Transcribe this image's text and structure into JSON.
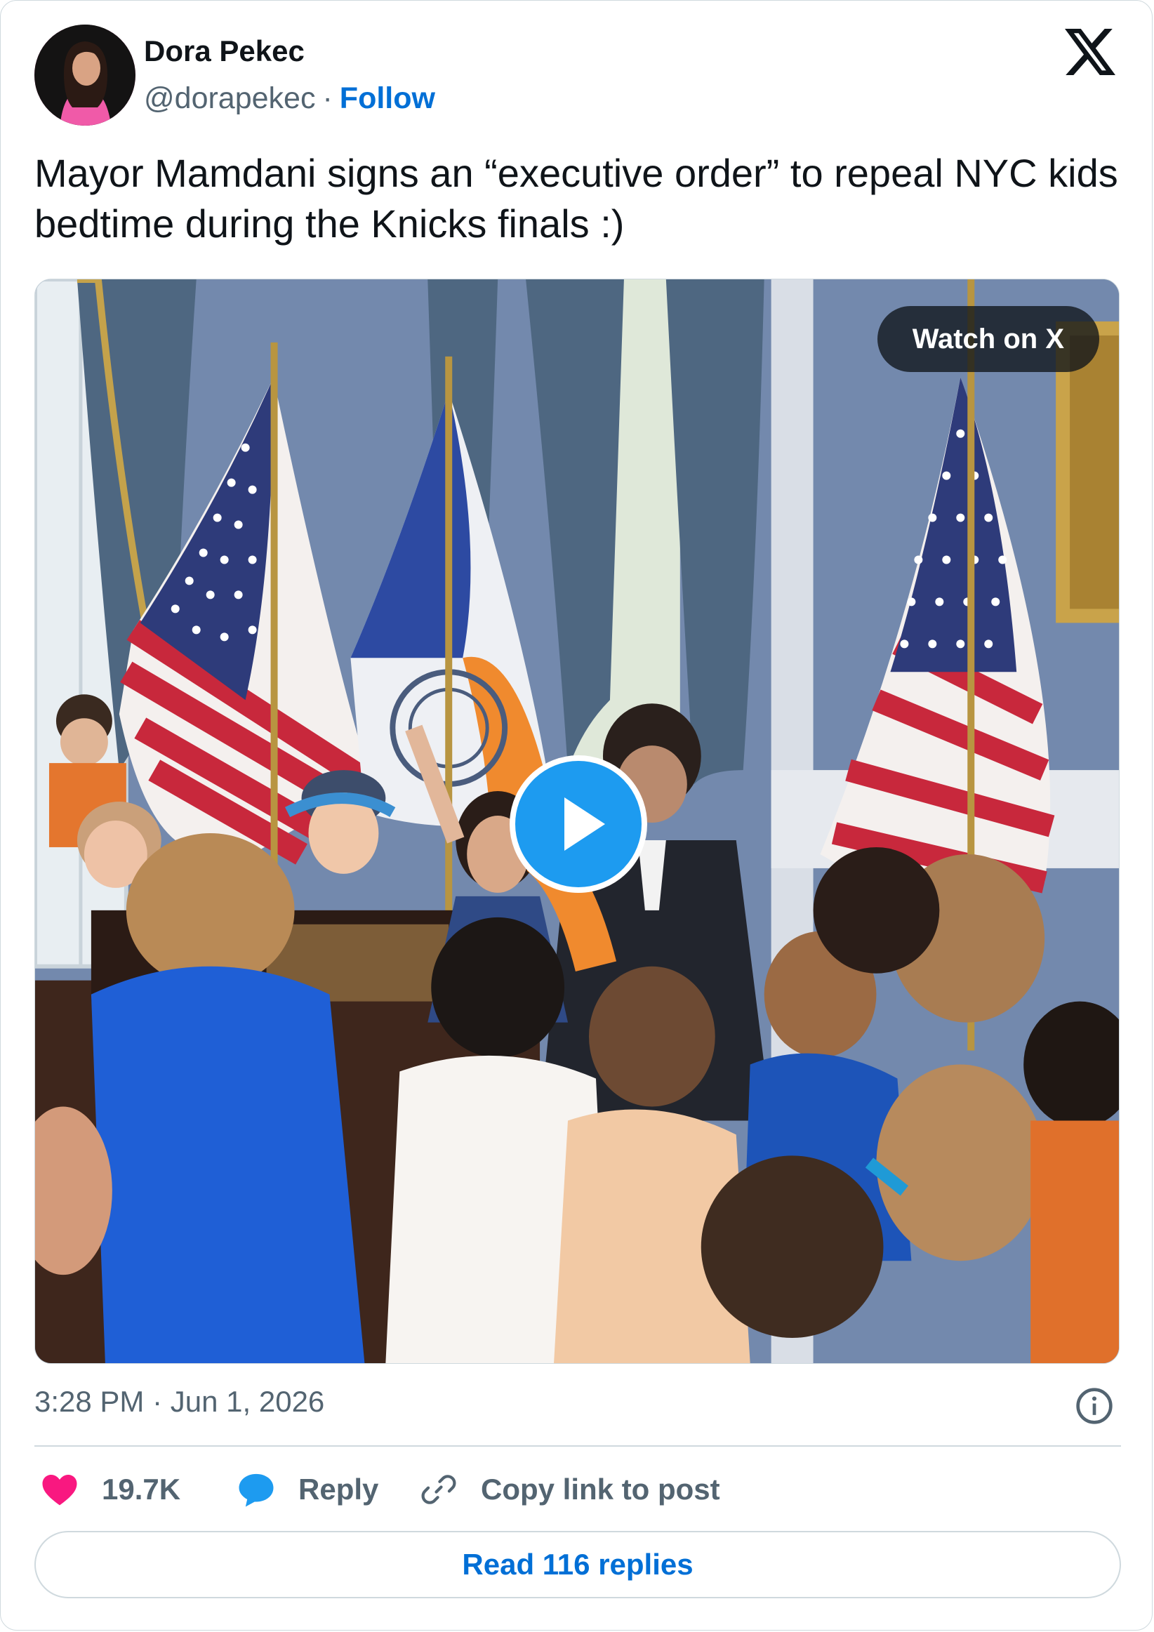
{
  "author": {
    "name": "Dora Pekec",
    "handle": "@dorapekec",
    "separator": "·",
    "follow_label": "Follow"
  },
  "brand": {
    "logo_icon": "x-logo-icon"
  },
  "tweet": {
    "text": "Mayor Mamdani signs an “executive order” to repeal NYC kids bedtime during the Knicks finals :)"
  },
  "media": {
    "watch_label": "Watch on X",
    "play_icon": "play-icon"
  },
  "meta": {
    "time": "3:28 PM",
    "separator": "·",
    "date": "Jun 1, 2026",
    "info_icon": "info-icon"
  },
  "actions": {
    "likes": "19.7K",
    "reply_label": "Reply",
    "copy_label": "Copy link to post"
  },
  "read_replies_label": "Read 116 replies",
  "colors": {
    "accent": "#006fd6",
    "like": "#f91880",
    "reply": "#1d9bf0",
    "muted": "#536471",
    "border": "#cfd9de"
  }
}
